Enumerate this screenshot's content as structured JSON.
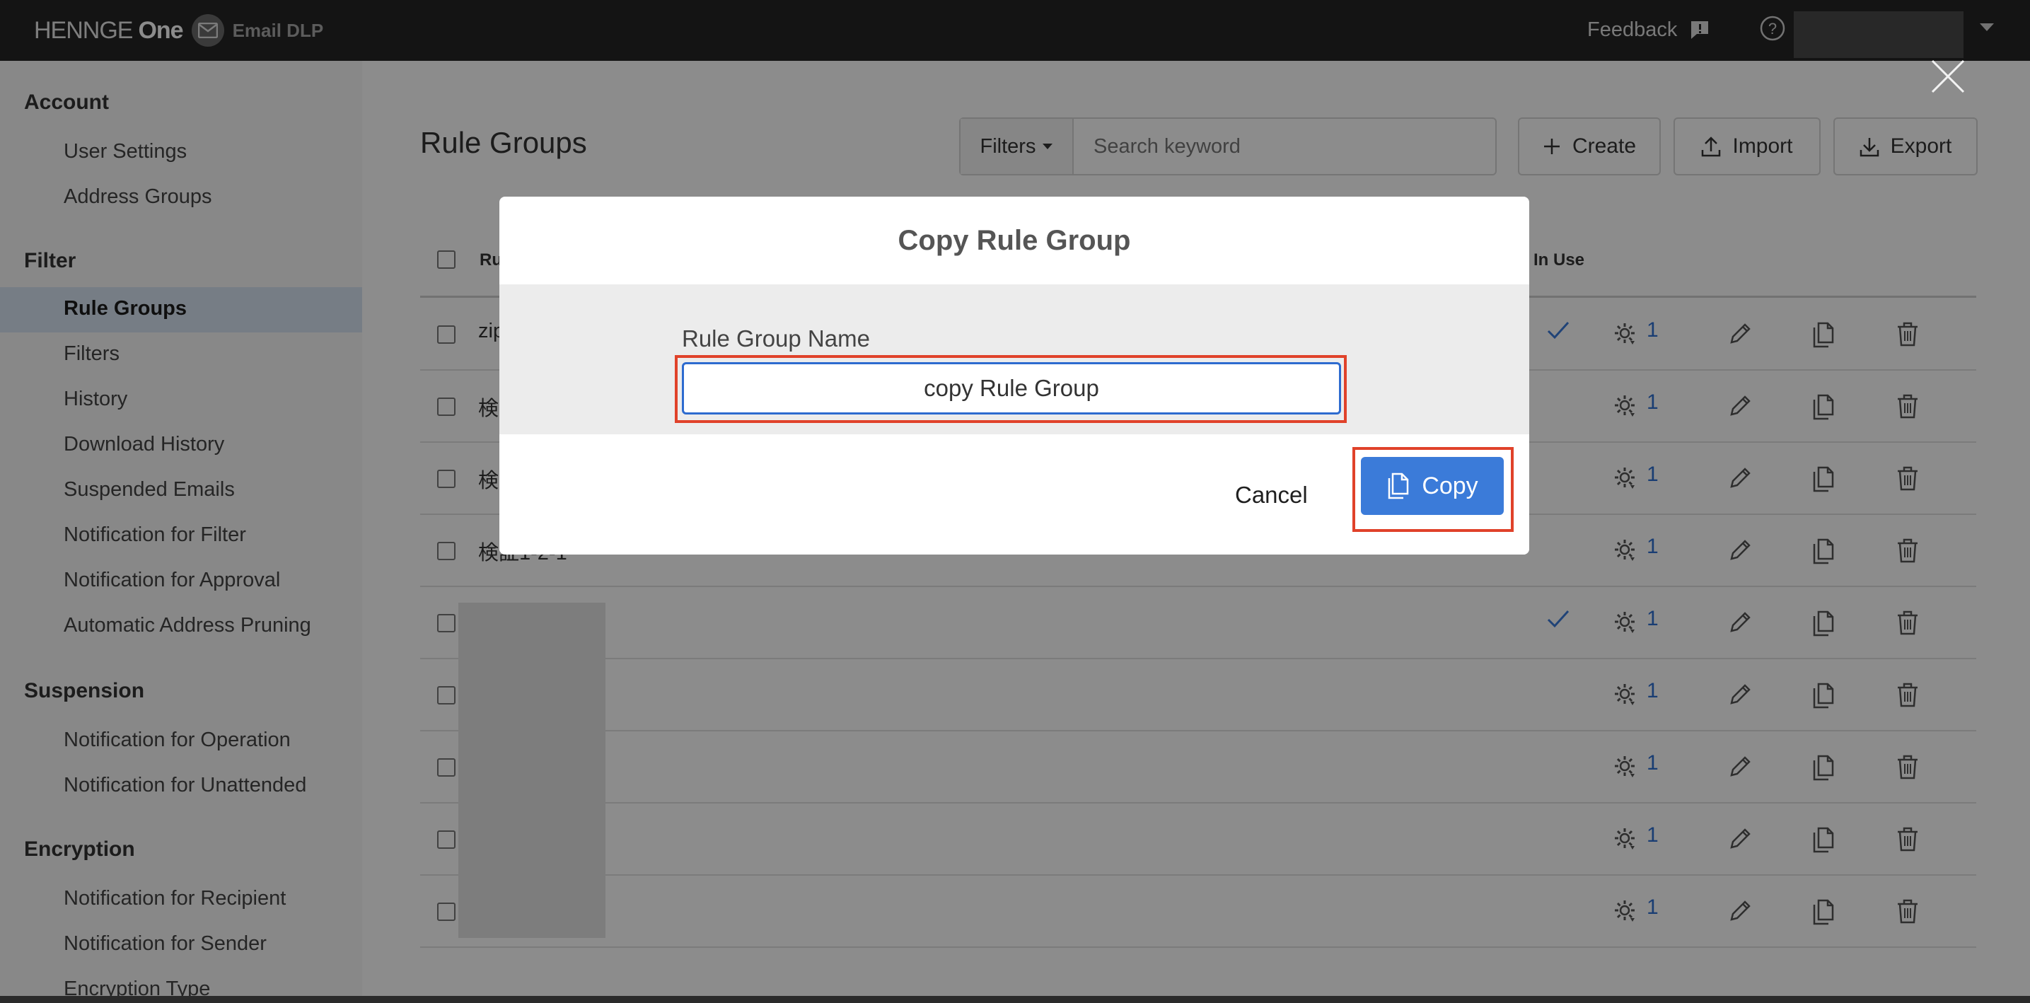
{
  "header": {
    "brand_henng": "HENNGE",
    "brand_one": "One",
    "product": "Email DLP",
    "feedback_label": "Feedback",
    "help_glyph": "?",
    "icons": {
      "mail": "mail-icon",
      "feedback": "feedback-icon",
      "help": "help-icon",
      "dropdown": "caret-down-icon"
    }
  },
  "sidebar": {
    "sections": [
      {
        "title": "Account",
        "items": [
          "User Settings",
          "Address Groups"
        ]
      },
      {
        "title": "Filter",
        "items": [
          "Rule Groups",
          "Filters",
          "History",
          "Download History",
          "Suspended Emails",
          "Notification for Filter",
          "Notification for Approval",
          "Automatic Address Pruning"
        ]
      },
      {
        "title": "Suspension",
        "items": [
          "Notification for Operation",
          "Notification for Unattended"
        ]
      },
      {
        "title": "Encryption",
        "items": [
          "Notification for Recipient",
          "Notification for Sender",
          "Encryption Type"
        ]
      }
    ],
    "active_item": "Rule Groups"
  },
  "main": {
    "title": "Rule Groups",
    "filters_label": "Filters",
    "search_placeholder": "Search keyword",
    "create_label": "Create",
    "import_label": "Import",
    "export_label": "Export",
    "table": {
      "col_name_partial": "Ru",
      "col_in_use": "In Use",
      "rows": [
        {
          "name": "zip",
          "in_use": true,
          "count": "1"
        },
        {
          "name": "検",
          "in_use": false,
          "count": "1"
        },
        {
          "name": "検",
          "in_use": false,
          "count": "1"
        },
        {
          "name": "検証1-2-1",
          "in_use": false,
          "count": "1"
        },
        {
          "name": "",
          "in_use": true,
          "count": "1"
        },
        {
          "name": "",
          "in_use": false,
          "count": "1"
        },
        {
          "name": "",
          "in_use": false,
          "count": "1"
        },
        {
          "name": "",
          "in_use": false,
          "count": "1"
        },
        {
          "name": "",
          "in_use": false,
          "count": "1"
        }
      ]
    }
  },
  "modal": {
    "title": "Copy Rule Group",
    "field_label": "Rule Group Name",
    "field_value": "copy Rule Group",
    "cancel_label": "Cancel",
    "copy_label": "Copy",
    "highlight_color": "#e0422a",
    "primary_color": "#3b7bd9"
  }
}
